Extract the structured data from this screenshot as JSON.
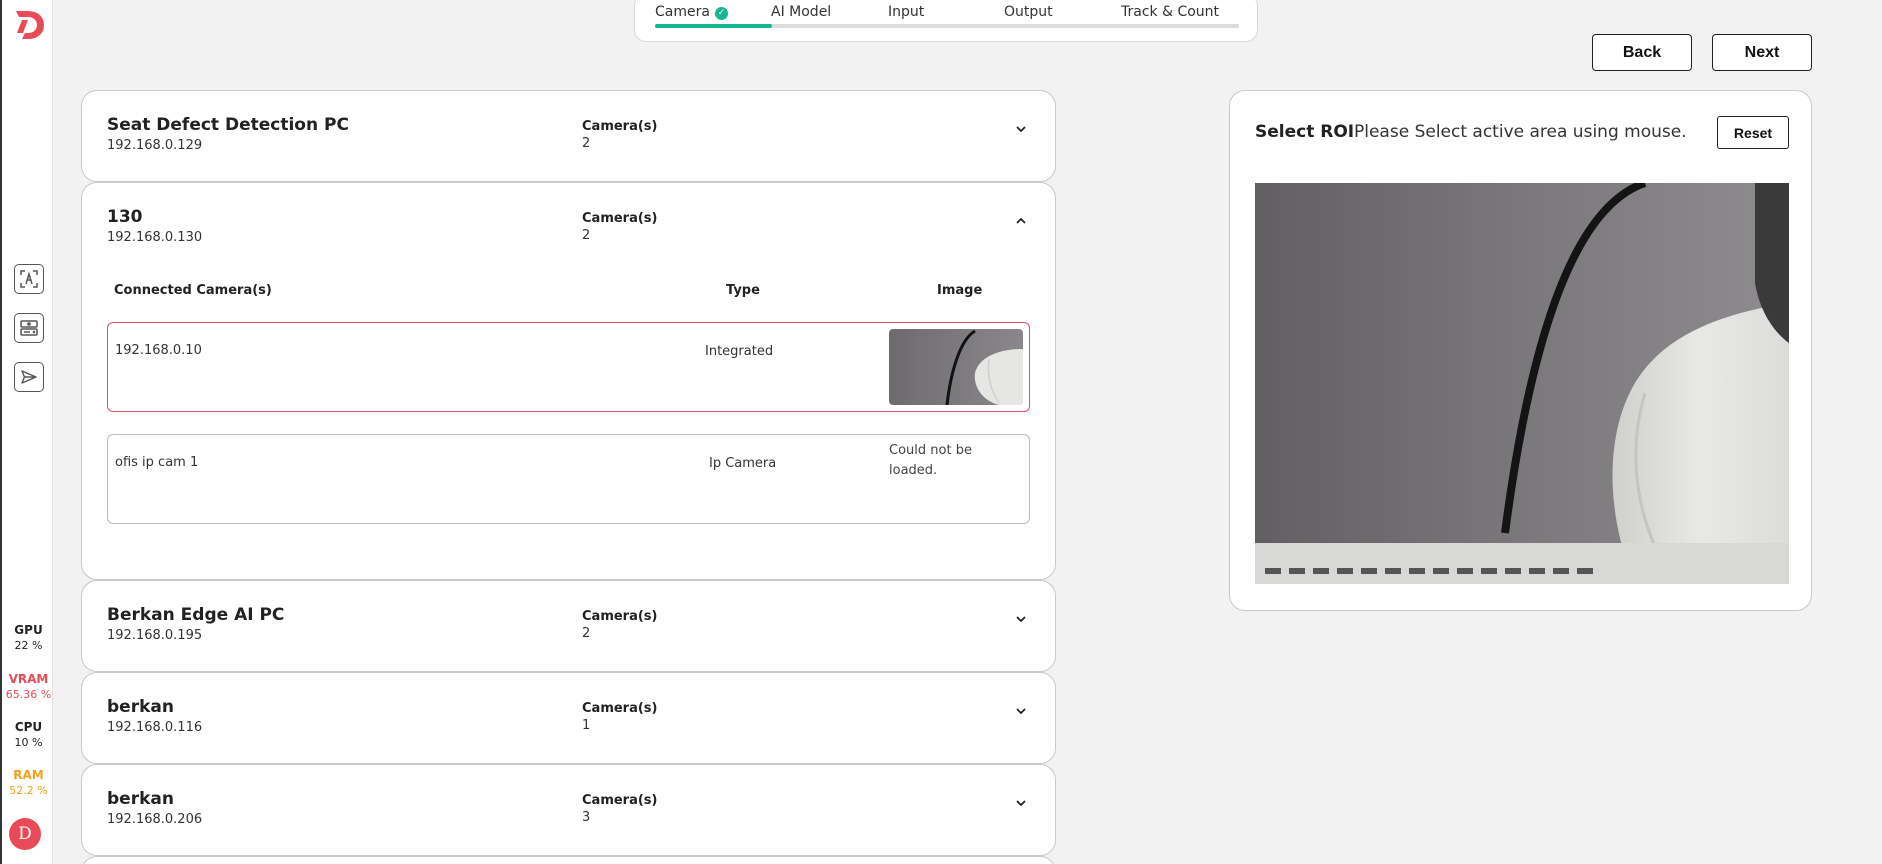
{
  "app": {
    "logo_letter": "D"
  },
  "sidebar": {
    "stats": [
      {
        "key": "GPU",
        "value": "22 %",
        "color": "#222222"
      },
      {
        "key": "VRAM",
        "value": "65.36 %",
        "color": "#e94a57"
      },
      {
        "key": "CPU",
        "value": "10 %",
        "color": "#222222"
      },
      {
        "key": "RAM",
        "value": "52.2 %",
        "color": "#f0a21a"
      }
    ],
    "avatar_letter": "D"
  },
  "stepper": {
    "steps": [
      "Camera",
      "AI Model",
      "Input",
      "Output",
      "Track & Count"
    ],
    "active_index": 0,
    "progress": 0.2,
    "accent": "#17b890"
  },
  "nav": {
    "back_label": "Back",
    "next_label": "Next"
  },
  "devices": [
    {
      "name": "Seat Defect Detection PC",
      "ip": "192.168.0.129",
      "cameras_label": "Camera(s)",
      "camera_count": "2",
      "expanded": false
    },
    {
      "name": "130",
      "ip": "192.168.0.130",
      "cameras_label": "Camera(s)",
      "camera_count": "2",
      "expanded": true,
      "table": {
        "headers": {
          "connected": "Connected Camera(s)",
          "type": "Type",
          "image": "Image"
        },
        "rows": [
          {
            "name": "192.168.0.10",
            "type": "Integrated",
            "image_alt": "",
            "selected": true
          },
          {
            "name": "ofis ip cam 1",
            "type": "Ip Camera",
            "image_alt": "Could not be loaded.",
            "selected": false
          }
        ]
      }
    },
    {
      "name": "Berkan Edge AI PC",
      "ip": "192.168.0.195",
      "cameras_label": "Camera(s)",
      "camera_count": "2",
      "expanded": false
    },
    {
      "name": "berkan",
      "ip": "192.168.0.116",
      "cameras_label": "Camera(s)",
      "camera_count": "1",
      "expanded": false
    },
    {
      "name": "berkan",
      "ip": "192.168.0.206",
      "cameras_label": "Camera(s)",
      "camera_count": "3",
      "expanded": false
    }
  ],
  "roi": {
    "title": "Select ROI",
    "hint": "Please Select active area using mouse.",
    "reset_label": "Reset"
  },
  "colors": {
    "selected_border": "#e94a6a",
    "accent": "#17b890",
    "logo": "#e94a57"
  }
}
